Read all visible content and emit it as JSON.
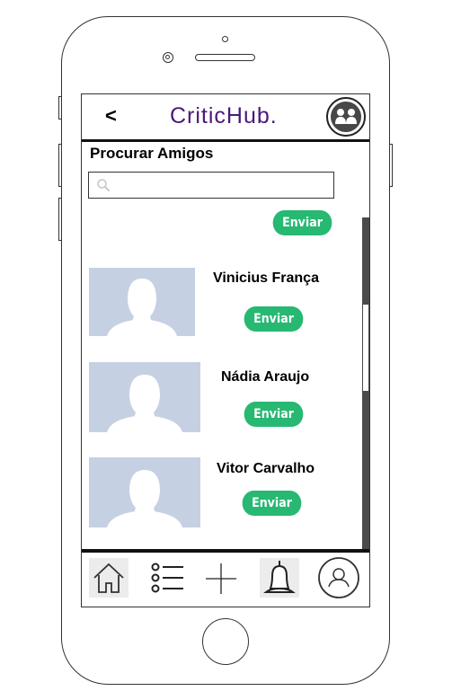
{
  "header": {
    "back_label": "<",
    "logo": "CriticHub.",
    "friends_icon": "people-icon"
  },
  "page": {
    "title": "Procurar Amigos",
    "search_placeholder": "",
    "search_icon": "search-icon"
  },
  "colors": {
    "accent": "#27b872",
    "logo": "#4a1a78",
    "avatar_bg": "#c6d0e3"
  },
  "top_send_label": "Enviar",
  "friends": [
    {
      "name": "Vinicius França",
      "button_label": "Enviar"
    },
    {
      "name": "Nádia Araujo",
      "button_label": "Enviar"
    },
    {
      "name": "Vitor Carvalho",
      "button_label": "Enviar"
    }
  ],
  "navbar": {
    "items": [
      "home-icon",
      "list-icon",
      "plus-icon",
      "bell-icon",
      "profile-icon"
    ]
  }
}
